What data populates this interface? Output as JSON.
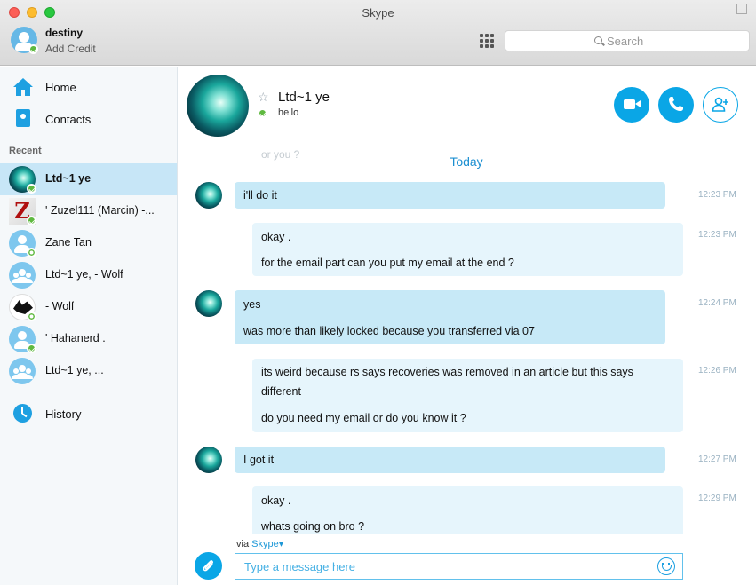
{
  "window": {
    "title": "Skype"
  },
  "account": {
    "name": "destiny",
    "sub": "Add Credit"
  },
  "search": {
    "placeholder": "Search"
  },
  "sidebar": {
    "nav": [
      {
        "label": "Home",
        "icon": "home-icon"
      },
      {
        "label": "Contacts",
        "icon": "contacts-icon"
      }
    ],
    "recent_heading": "Recent",
    "recent": [
      {
        "label": "Ltd~1 ye",
        "avatar": "aurora",
        "status": "online",
        "active": true
      },
      {
        "label": "' Zuzel111 (Marcin) -...",
        "avatar": "z-logo",
        "status": "online"
      },
      {
        "label": "Zane Tan",
        "avatar": "person",
        "status": "offline"
      },
      {
        "label": "Ltd~1 ye, - Wolf",
        "avatar": "group"
      },
      {
        "label": "- Wolf",
        "avatar": "wolf",
        "status": "offline"
      },
      {
        "label": "' Hahanerd  .",
        "avatar": "person",
        "status": "online"
      },
      {
        "label": "Ltd~1 ye, ...",
        "avatar": "group"
      }
    ],
    "history": {
      "label": "History",
      "icon": "history-icon"
    }
  },
  "chat": {
    "name": "Ltd~1 ye",
    "mood": "hello",
    "ghost": "or you ?",
    "day": "Today",
    "messages": [
      {
        "dir": "in",
        "lines": [
          "i'll do it"
        ],
        "time": "12:23 PM"
      },
      {
        "dir": "out",
        "lines": [
          "okay .",
          "for the email part can you put my email at the end ?"
        ],
        "time": "12:23 PM"
      },
      {
        "dir": "in",
        "lines": [
          "yes",
          "was more than likely locked because you transferred via 07"
        ],
        "time": "12:24 PM"
      },
      {
        "dir": "out",
        "lines": [
          "its weird because rs says recoveries was removed in an article but this says",
          "different",
          "do you need my email or do you know it ?"
        ],
        "time": "12:26 PM"
      },
      {
        "dir": "in",
        "lines": [
          "I got it"
        ],
        "time": "12:27 PM"
      },
      {
        "dir": "out",
        "lines": [
          "okay .",
          "whats going on bro ?"
        ],
        "time": "12:29 PM"
      }
    ]
  },
  "composer": {
    "via": "via",
    "via_link": "Skype",
    "placeholder": "Type a message here"
  },
  "colors": {
    "accent": "#0aa6e6",
    "bubble_in": "#c7e9f7",
    "bubble_out": "#e6f5fc",
    "online": "#5fb940"
  }
}
